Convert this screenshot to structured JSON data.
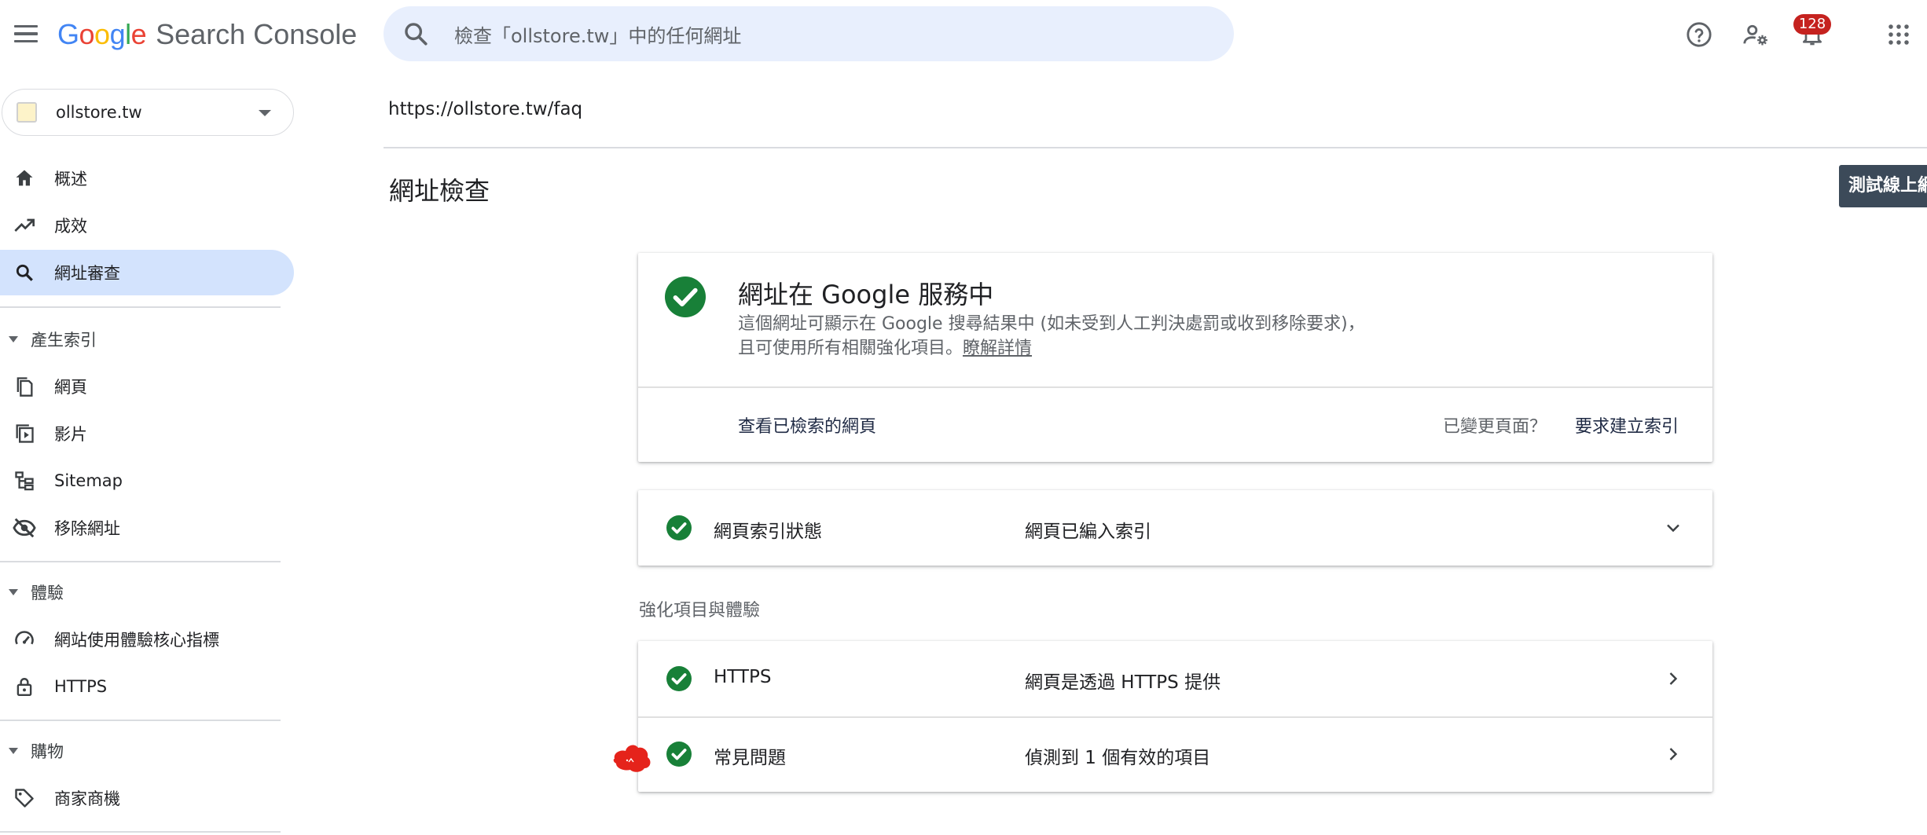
{
  "app": {
    "logo_letters": [
      "G",
      "o",
      "o",
      "g",
      "l",
      "e"
    ],
    "logo_colors": [
      "#4285f4",
      "#ea4335",
      "#fbbc05",
      "#4285f4",
      "#34a853",
      "#ea4335"
    ],
    "product_name": "Search Console"
  },
  "search": {
    "placeholder": "檢查「ollstore.tw」中的任何網址",
    "icon": "search-icon"
  },
  "header_icons": {
    "help": "help-icon",
    "users": "manage-users-icon",
    "notifications": "bell-icon",
    "notification_count": "128",
    "apps": "apps-grid-icon"
  },
  "property": {
    "name": "ollstore.tw"
  },
  "sidebar": {
    "top_items": [
      {
        "label": "概述",
        "icon": "home-icon"
      },
      {
        "label": "成效",
        "icon": "trending-up-icon"
      },
      {
        "label": "網址審查",
        "icon": "search-icon",
        "active": true
      }
    ],
    "sections": [
      {
        "title": "產生索引",
        "items": [
          {
            "label": "網頁",
            "icon": "pages-icon"
          },
          {
            "label": "影片",
            "icon": "video-icon"
          },
          {
            "label": "Sitemap",
            "icon": "sitemap-icon"
          },
          {
            "label": "移除網址",
            "icon": "eye-off-icon"
          }
        ]
      },
      {
        "title": "體驗",
        "items": [
          {
            "label": "網站使用體驗核心指標",
            "icon": "speed-gauge-icon"
          },
          {
            "label": "HTTPS",
            "icon": "lock-icon"
          }
        ]
      },
      {
        "title": "購物",
        "items": [
          {
            "label": "商家商機",
            "icon": "tag-icon"
          }
        ]
      }
    ]
  },
  "main": {
    "inspected_url": "https://ollstore.tw/faq",
    "page_title": "網址檢查",
    "test_live_button": "測試線上網址"
  },
  "status_card": {
    "title": "網址在 Google 服務中",
    "description_line1": "這個網址可顯示在 Google 搜尋結果中 (如未受到人工判決處罰或收到移除要求)，",
    "description_line2": "且可使用所有相關強化項目。",
    "learn_more": "瞭解詳情",
    "view_crawled": "查看已檢索的網頁",
    "changed_question": "已變更頁面？",
    "request_indexing": "要求建立索引"
  },
  "index_row": {
    "label": "網頁索引狀態",
    "value": "網頁已編入索引"
  },
  "enhancements": {
    "heading": "強化項目與體驗",
    "rows": [
      {
        "label": "HTTPS",
        "value": "網頁是透過 HTTPS 提供"
      },
      {
        "label": "常見問題",
        "value": "偵測到 1 個有效的項目"
      }
    ]
  },
  "colors": {
    "check_green": "#188038",
    "active_nav": "#d3e3fd",
    "search_bg": "#e8effd",
    "badge_red": "#c5221f"
  }
}
